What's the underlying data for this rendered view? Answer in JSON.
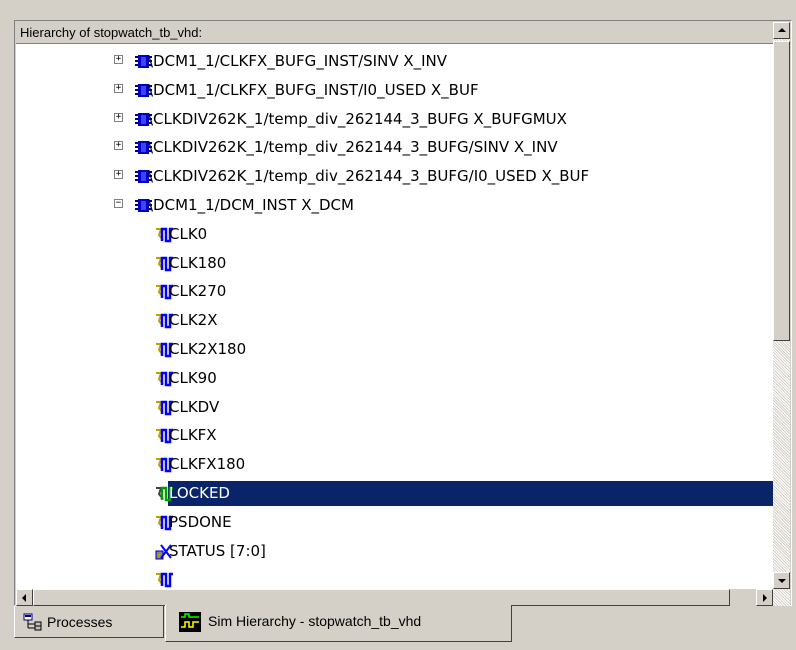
{
  "window": {
    "header_title": "Hierarchy of stopwatch_tb_vhd:"
  },
  "tree": {
    "items": [
      {
        "label": "\\DCM1_1/CLKFX_BUFG_INST/SINV X_INV",
        "kind": "instance",
        "expander": "+"
      },
      {
        "label": "\\DCM1_1/CLKFX_BUFG_INST/I0_USED X_BUF",
        "kind": "instance",
        "expander": "+"
      },
      {
        "label": "\\CLKDIV262K_1/temp_div_262144_3_BUFG X_BUFGMUX",
        "kind": "instance",
        "expander": "+"
      },
      {
        "label": "\\CLKDIV262K_1/temp_div_262144_3_BUFG/SINV X_INV",
        "kind": "instance",
        "expander": "+"
      },
      {
        "label": "\\CLKDIV262K_1/temp_div_262144_3_BUFG/I0_USED X_BUF",
        "kind": "instance",
        "expander": "+"
      },
      {
        "label": "\\DCM1_1/DCM_INST X_DCM",
        "kind": "instance",
        "expander": "−"
      },
      {
        "label": "CLK0",
        "kind": "signal-out"
      },
      {
        "label": "CLK180",
        "kind": "signal-out"
      },
      {
        "label": "CLK270",
        "kind": "signal-out"
      },
      {
        "label": "CLK2X",
        "kind": "signal-out"
      },
      {
        "label": "CLK2X180",
        "kind": "signal-out"
      },
      {
        "label": "CLK90",
        "kind": "signal-out"
      },
      {
        "label": "CLKDV",
        "kind": "signal-out"
      },
      {
        "label": "CLKFX",
        "kind": "signal-out"
      },
      {
        "label": "CLKFX180",
        "kind": "signal-out"
      },
      {
        "label": "LOCKED",
        "kind": "signal-selected",
        "selected": true
      },
      {
        "label": "PSDONE",
        "kind": "signal-out"
      },
      {
        "label": "STATUS [7:0]",
        "kind": "bus"
      },
      {
        "label": "",
        "kind": "signal-out"
      }
    ]
  },
  "tabs": [
    {
      "label": "Processes",
      "icon": "processes-icon",
      "active": false
    },
    {
      "label": "Sim Hierarchy - stopwatch_tb_vhd",
      "icon": "sim-hierarchy-icon",
      "active": true
    }
  ],
  "colors": {
    "selection": "#0a246a",
    "instance_icon": "#0000c0",
    "signal_icon": "#0000ff",
    "selected_signal_icon": "#00a000"
  }
}
